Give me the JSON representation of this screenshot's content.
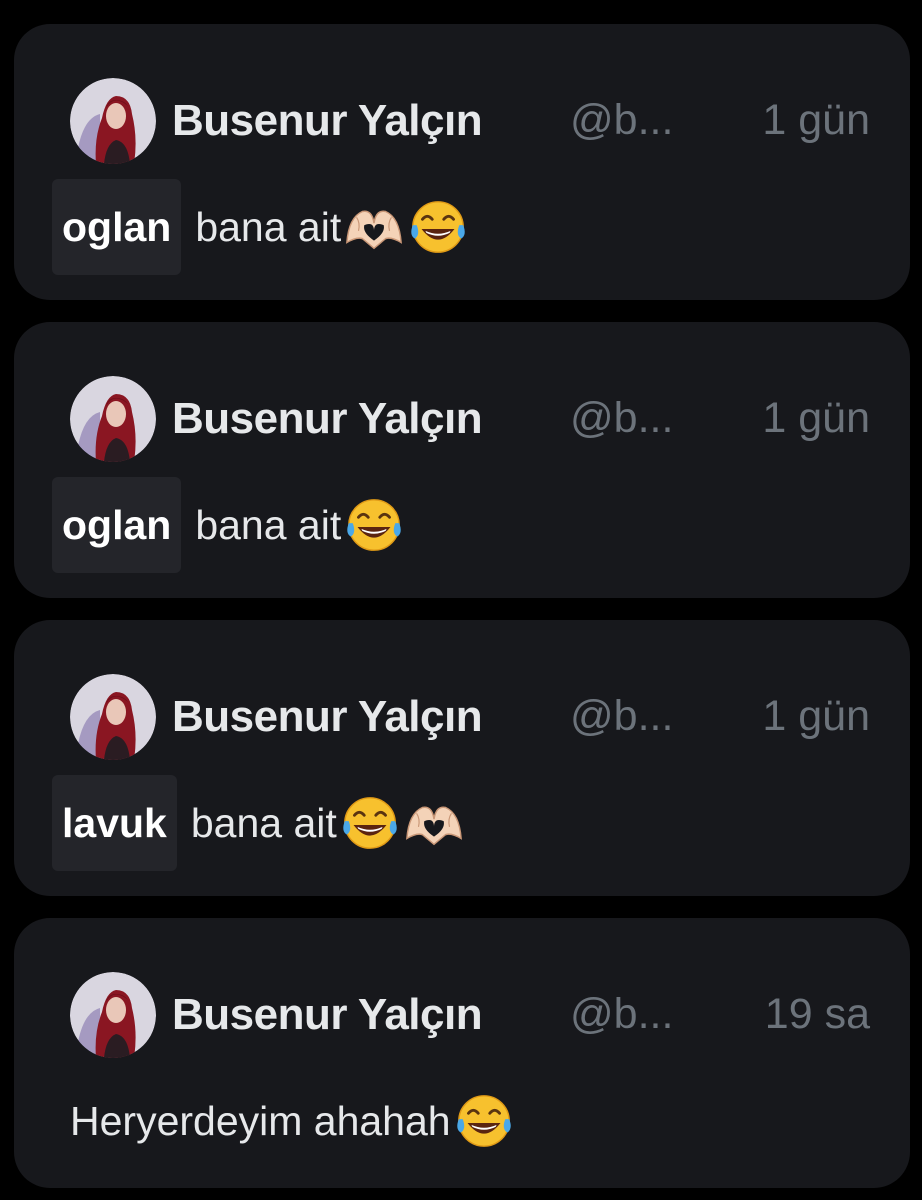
{
  "tweets": [
    {
      "author_name": "Busenur Yalçın",
      "handle": "@b...",
      "time": "1 gün",
      "highlighted_word": "oglan",
      "text": "bana ait",
      "emojis": [
        "heart-hands",
        "tears-of-joy"
      ]
    },
    {
      "author_name": "Busenur Yalçın",
      "handle": "@b...",
      "time": "1 gün",
      "highlighted_word": "oglan",
      "text": "bana ait",
      "emojis": [
        "tears-of-joy"
      ]
    },
    {
      "author_name": "Busenur Yalçın",
      "handle": "@b...",
      "time": "1 gün",
      "highlighted_word": "lavuk",
      "text": "bana ait",
      "emojis": [
        "tears-of-joy",
        "heart-hands"
      ]
    },
    {
      "author_name": "Busenur Yalçın",
      "handle": "@b...",
      "time": "19 sa",
      "highlighted_word": "",
      "text": "Heryerdeyim ahahah",
      "emojis": [
        "tears-of-joy"
      ]
    }
  ],
  "colors": {
    "page_background": "#000000",
    "card_background": "#17181c",
    "name_color": "#e6e8ea",
    "muted_color": "#6c737b",
    "highlight_box": "#24252a"
  }
}
